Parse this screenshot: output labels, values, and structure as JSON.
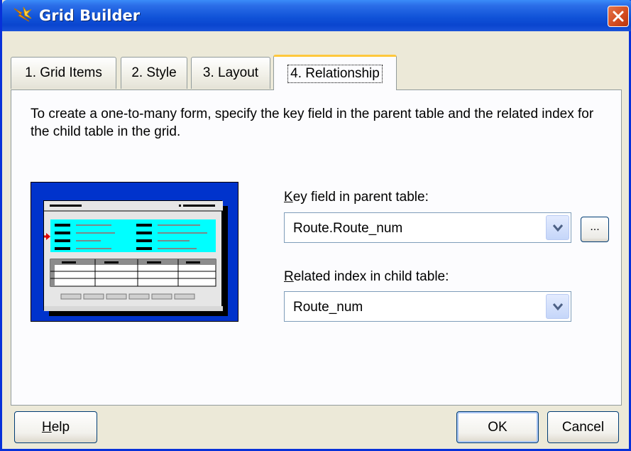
{
  "window": {
    "title": "Grid Builder",
    "icon": "lightning-wizard-icon",
    "close_icon": "close-icon"
  },
  "tabs": [
    {
      "label": "1. Grid Items",
      "active": false
    },
    {
      "label": "2. Style",
      "active": false
    },
    {
      "label": "3. Layout",
      "active": false
    },
    {
      "label": "4. Relationship",
      "active": true
    }
  ],
  "relationship": {
    "description": "To create a one-to-many form, specify the key field in the parent table and the related index for the child table in the grid.",
    "key_field": {
      "label_accel": "K",
      "label_rest": "ey field in parent table:",
      "value": "Route.Route_num",
      "browse_label": "..."
    },
    "related_index": {
      "label_accel": "R",
      "label_rest": "elated index in child table:",
      "value": "Route_num"
    }
  },
  "buttons": {
    "help_accel": "H",
    "help_rest": "elp",
    "ok": "OK",
    "cancel": "Cancel"
  },
  "colors": {
    "titlebar": "#0A45CF",
    "illustration_bg": "#0033CC",
    "illustration_highlight": "#00FFFF",
    "active_tab_accent": "#FFC83C"
  }
}
